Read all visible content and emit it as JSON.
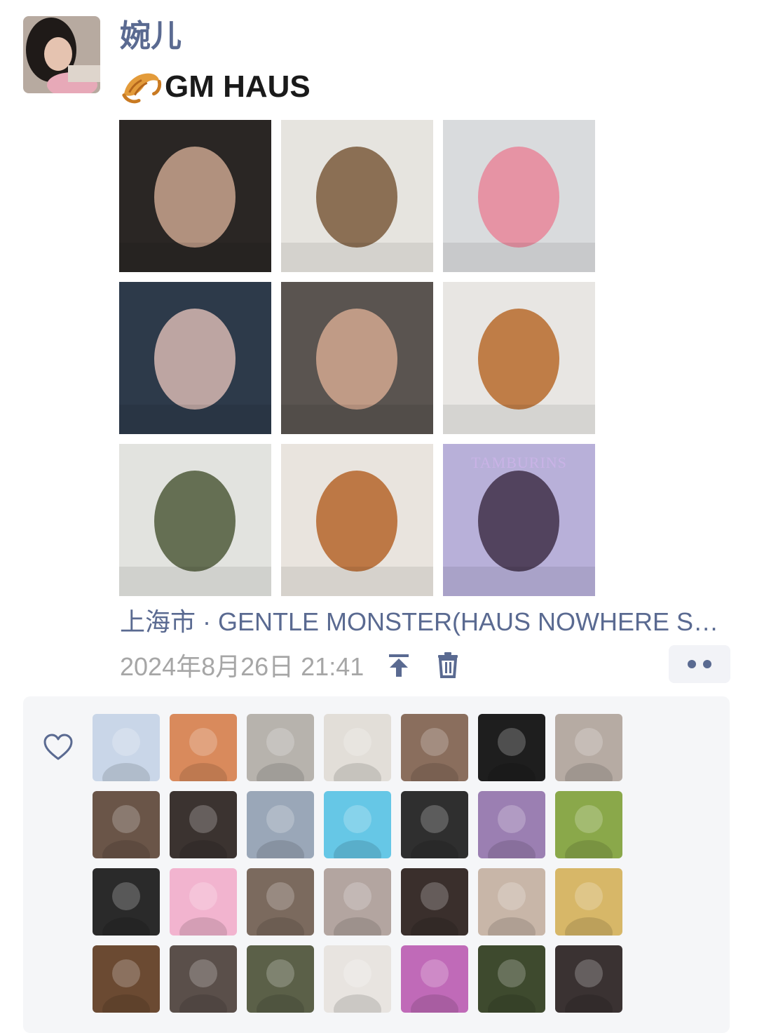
{
  "author": {
    "name": "婉儿",
    "avatar_icon": "user-avatar-photo"
  },
  "post": {
    "text": "GM HAUS",
    "emoji_icon": "croissant-icon",
    "photos": [
      {
        "name": "photo-sculpture-head",
        "bg": "#2a2624",
        "accent": "#c9a58e",
        "caption": ""
      },
      {
        "name": "photo-elderly-couple",
        "bg": "#e6e4df",
        "accent": "#7a5a3c",
        "caption": ""
      },
      {
        "name": "photo-mirror-selfie",
        "bg": "#d9dbdd",
        "accent": "#e8869a",
        "caption": ""
      },
      {
        "name": "photo-billboard-screen",
        "bg": "#2d3a4a",
        "accent": "#d7b9b2",
        "caption": ""
      },
      {
        "name": "photo-head-with-visitor",
        "bg": "#5a5450",
        "accent": "#d2a88f",
        "caption": ""
      },
      {
        "name": "photo-pastry-boxing-gloves",
        "bg": "#e8e6e3",
        "accent": "#b76a2c",
        "caption": ""
      },
      {
        "name": "photo-gallery-painting",
        "bg": "#e2e3df",
        "accent": "#4f5a3b",
        "caption": ""
      },
      {
        "name": "photo-pastry-barbell",
        "bg": "#e9e4de",
        "accent": "#b5652a",
        "caption": ""
      },
      {
        "name": "photo-tamburins-poster",
        "bg": "#b8b0d9",
        "accent": "#3f3048",
        "caption": "TAMBURINS"
      }
    ],
    "location": "上海市 · GENTLE MONSTER(HAUS NOWHERE SHANGHAI)",
    "timestamp": "2024年8月26日 21:41"
  },
  "actions": {
    "pin_icon": "pin-top-icon",
    "delete_icon": "trash-icon",
    "more_icon": "more-dots-icon"
  },
  "likes": {
    "icon": "heart-outline-icon",
    "likers": [
      {
        "name": "liker-1",
        "color": "#c9d6e8"
      },
      {
        "name": "liker-2",
        "color": "#d98a5c"
      },
      {
        "name": "liker-3",
        "color": "#b7b3ad"
      },
      {
        "name": "liker-4",
        "color": "#e2ded8"
      },
      {
        "name": "liker-5",
        "color": "#8a6e5d"
      },
      {
        "name": "liker-6",
        "color": "#1e1e1e"
      },
      {
        "name": "liker-7",
        "color": "#b6aba3"
      },
      {
        "name": "liker-8",
        "color": "#6a5548"
      },
      {
        "name": "liker-9",
        "color": "#3b3330"
      },
      {
        "name": "liker-10",
        "color": "#9aa7b8"
      },
      {
        "name": "liker-11",
        "color": "#66c7e6"
      },
      {
        "name": "liker-12",
        "color": "#2f2f2f"
      },
      {
        "name": "liker-13",
        "color": "#9b7fb2"
      },
      {
        "name": "liker-14",
        "color": "#8aa84a"
      },
      {
        "name": "liker-15",
        "color": "#2a2a2a"
      },
      {
        "name": "liker-16",
        "color": "#f2b4cf"
      },
      {
        "name": "liker-17",
        "color": "#7b6a5e"
      },
      {
        "name": "liker-18",
        "color": "#b3a5a0"
      },
      {
        "name": "liker-19",
        "color": "#3a2f2c"
      },
      {
        "name": "liker-20",
        "color": "#c8b6a8"
      },
      {
        "name": "liker-21",
        "color": "#d7b768"
      },
      {
        "name": "liker-22",
        "color": "#6b4a32"
      },
      {
        "name": "liker-23",
        "color": "#5a4f4a"
      },
      {
        "name": "liker-24",
        "color": "#5b6048"
      },
      {
        "name": "liker-25",
        "color": "#e8e4e0"
      },
      {
        "name": "liker-26",
        "color": "#c06ab8"
      },
      {
        "name": "liker-27",
        "color": "#3e4a2e"
      },
      {
        "name": "liker-28",
        "color": "#3a3232"
      }
    ]
  }
}
